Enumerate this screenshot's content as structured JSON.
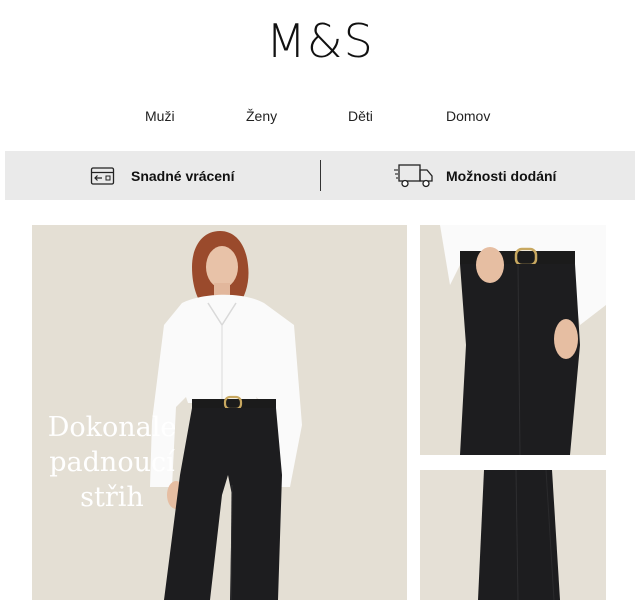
{
  "brand": {
    "logo_text": "M&S"
  },
  "nav": {
    "items": [
      {
        "label": "Muži"
      },
      {
        "label": "Ženy"
      },
      {
        "label": "Děti"
      },
      {
        "label": "Domov"
      }
    ]
  },
  "service_bar": {
    "returns_label": "Snadné vrácení",
    "returns_icon": "return-box-icon",
    "delivery_label": "Možnosti dodání",
    "delivery_icon": "delivery-truck-icon",
    "background": "#eaeaea"
  },
  "hero": {
    "caption_lines": [
      "Dokonale",
      "padnoucí",
      "střih"
    ]
  },
  "colors": {
    "background": "#ffffff",
    "text": "#111111",
    "photo_backdrop": "#e4dfd4"
  }
}
